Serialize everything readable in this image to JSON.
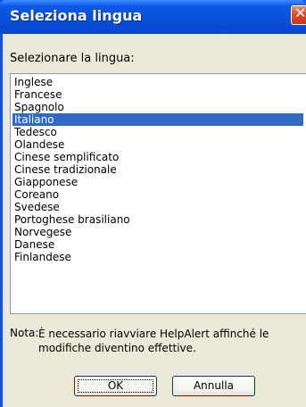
{
  "window": {
    "title": "Seleziona lingua",
    "close_glyph": "✕"
  },
  "dialog": {
    "prompt": "Selezionare la lingua:",
    "languages": [
      "Inglese",
      "Francese",
      "Spagnolo",
      "Italiano",
      "Tedesco",
      "Olandese",
      "Cinese semplificato",
      "Cinese tradizionale",
      "Giapponese",
      "Coreano",
      "Svedese",
      "Portoghese brasiliano",
      "Norvegese",
      "Danese",
      "Finlandese"
    ],
    "selected_language": "Italiano",
    "note_label": "Nota:",
    "note_text": "È necessario riavviare HelpAlert affinché le modifiche diventino effettive.",
    "ok_label": "OK",
    "cancel_label": "Annulla"
  },
  "colors": {
    "titlebar": "#0a4fd6",
    "selection": "#316ac5",
    "dialog_bg": "#ece9d8",
    "close_button": "#e0462a"
  },
  "icons": {
    "close": "close-icon"
  }
}
